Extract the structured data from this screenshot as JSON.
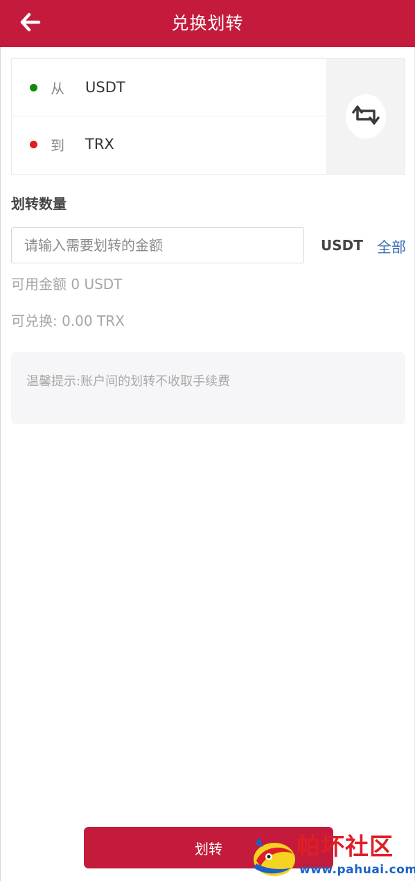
{
  "header": {
    "title": "兑换划转",
    "back_icon": "arrow-left-icon"
  },
  "pair": {
    "from": {
      "label": "从",
      "coin": "USDT",
      "dot_color": "#118a0c"
    },
    "to": {
      "label": "到",
      "coin": "TRX",
      "dot_color": "#e21b1b"
    },
    "swap_icon": "swap-arrows-icon"
  },
  "amount": {
    "section_label": "划转数量",
    "placeholder": "请输入需要划转的金额",
    "value": "",
    "unit": "USDT",
    "all_label": "全部"
  },
  "balance": {
    "available_text": "可用金额 0 USDT",
    "exchangeable_text": "可兑换: 0.00 TRX"
  },
  "tip": {
    "text": "温馨提示:账户间的划转不收取手续费"
  },
  "submit": {
    "label": "划转"
  },
  "watermark": {
    "title": "帕坏社区",
    "url": "www.pahuai.com"
  },
  "colors": {
    "brand": "#c41a3c",
    "link": "#3c6fb0"
  }
}
